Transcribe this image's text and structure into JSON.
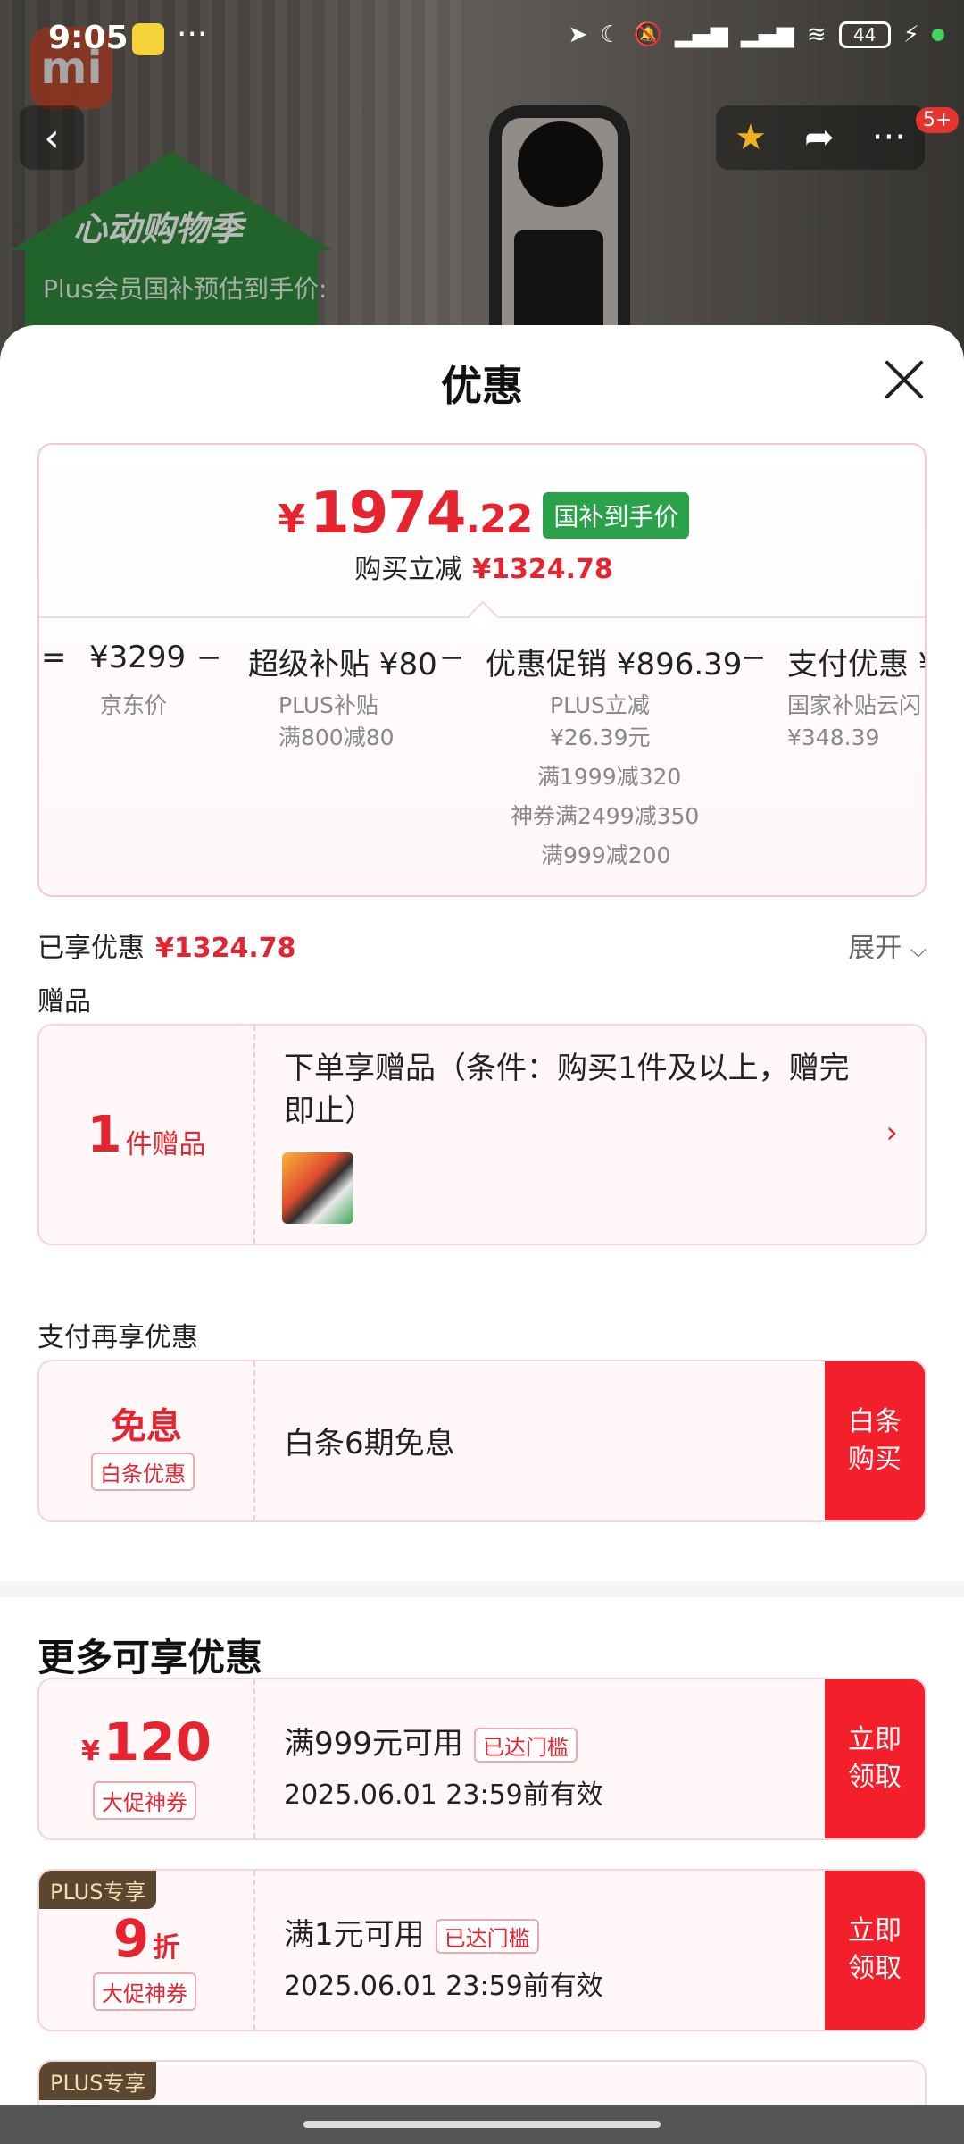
{
  "status_bar": {
    "time": "9:05",
    "battery": "44"
  },
  "background": {
    "house_title": "心动购物季",
    "house_sub": "Plus会员国补预估到手价:",
    "badge": "5+"
  },
  "sheet": {
    "title": "优惠"
  },
  "price": {
    "symbol": "¥",
    "integer": "1974",
    "decimal": ".22",
    "tag": "国补到手价",
    "saving_label": "购买立减",
    "saving_value": "¥1324.78"
  },
  "calc": {
    "equals": "=",
    "items": [
      {
        "amount": "¥3299",
        "subs": [
          "京东价"
        ]
      },
      {
        "amount": "超级补贴 ¥80",
        "subs": [
          "PLUS补贴",
          "满800减80"
        ]
      },
      {
        "amount": "优惠促销 ¥896.39",
        "subs": [
          "PLUS立减",
          "¥26.39元",
          "满1999减320",
          "神券满2499减350",
          "满999减200"
        ]
      },
      {
        "amount": "支付优惠 ¥",
        "subs": [
          "国家补贴云闪",
          "¥348.39"
        ]
      }
    ],
    "minus": "−"
  },
  "enjoyed": {
    "label": "已享优惠",
    "value": "¥1324.78",
    "expand": "展开"
  },
  "gift": {
    "section_label": "赠品",
    "count": "1",
    "unit": "件赠品",
    "text": "下单享赠品（条件：购买1件及以上，赠完即止）"
  },
  "pay": {
    "section_label": "支付再享优惠",
    "title": "免息",
    "tag": "白条优惠",
    "text": "白条6期免息",
    "button": "白条\n购买"
  },
  "more": {
    "title": "更多可享优惠",
    "coupons": [
      {
        "symbol": "¥",
        "amount": "120",
        "unit": "",
        "tag": "大促神券",
        "plus": "",
        "cond": "满999元可用",
        "reached": "已达门槛",
        "valid": "2025.06.01 23:59前有效",
        "button": "立即\n领取"
      },
      {
        "symbol": "",
        "amount": "9",
        "unit": "折",
        "tag": "大促神券",
        "plus": "PLUS专享",
        "cond": "满1元可用",
        "reached": "已达门槛",
        "valid": "2025.06.01 23:59前有效",
        "button": "立即\n领取"
      }
    ]
  }
}
